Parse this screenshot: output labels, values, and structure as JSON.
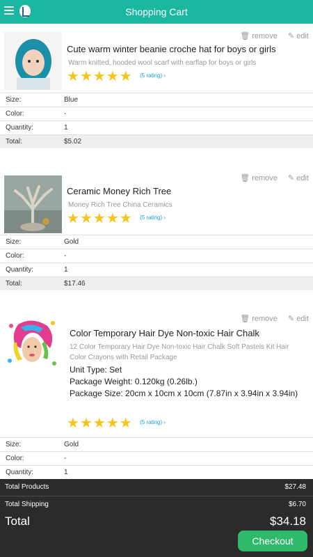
{
  "header": {
    "title": "Shopping Cart"
  },
  "actions": {
    "remove": "remove",
    "edit": "edit"
  },
  "items": [
    {
      "title": "Cute warm winter beanie croche hat for boys or girls",
      "subtitle": "Warm knitted, hooded wool scarf with earflap for boys or girls",
      "stars": 5,
      "rating_text": "(5 rating) ›",
      "rows": [
        {
          "key": "Size:",
          "value": "Blue"
        },
        {
          "key": "Color:",
          "value": "-"
        },
        {
          "key": "Quantity:",
          "value": "1"
        },
        {
          "key": "Total:",
          "value": "$5.02"
        }
      ]
    },
    {
      "title": "Ceramic Money Rich Tree",
      "subtitle": "Money Rich Tree China Ceramics",
      "stars": 5,
      "rating_text": "(5 rating) ›",
      "rows": [
        {
          "key": "Size:",
          "value": "Gold"
        },
        {
          "key": "Color:",
          "value": "-"
        },
        {
          "key": "Quantity:",
          "value": "1"
        },
        {
          "key": "Total:",
          "value": "$17.46"
        }
      ]
    },
    {
      "title": "Color Temporary Hair Dye Non-toxic Hair Chalk",
      "subtitle": "12 Color Temporary Hair Dye Non-toxic Hair Chalk Soft Pastels Kit Hair Color Crayons with Retail Package",
      "attributes": [
        "Unit Type: Set",
        "Package Weight: 0.120kg (0.26lb.)",
        "Package Size: 20cm x 10cm x 10cm (7.87in x 3.94in x 3.94in)"
      ],
      "stars": 5,
      "rating_text": "(5 rating) ›",
      "rows": [
        {
          "key": "Size:",
          "value": "Gold"
        },
        {
          "key": "Color:",
          "value": "-"
        },
        {
          "key": "Quantity:",
          "value": "1"
        }
      ]
    }
  ],
  "summary": {
    "total_products_label": "Total Products",
    "total_products_value": "$27.48",
    "total_shipping_label": "Total Shipping",
    "total_shipping_value": "$6.70",
    "total_label": "Total",
    "total_value": "$34.18",
    "checkout_label": "Checkout"
  },
  "colors": {
    "header": "#1cb7a0",
    "checkout": "#2eb96b",
    "star": "#f6c51b",
    "rating_link": "#1a9fd6",
    "summary_bg": "#2b2b2b"
  }
}
